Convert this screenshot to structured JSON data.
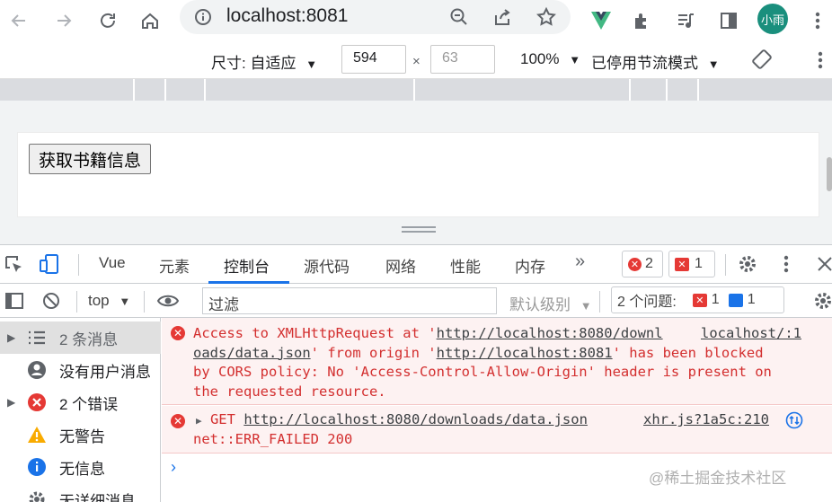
{
  "browser": {
    "url": "localhost:8081",
    "profile_name": "小雨",
    "icons": [
      "back-icon",
      "forward-icon",
      "reload-icon",
      "home-icon",
      "info-icon",
      "zoom-icon",
      "share-icon",
      "bookmark-star-icon",
      "vue-devtools-icon",
      "extensions-icon",
      "media-icon",
      "side-panel-icon",
      "menu-icon"
    ]
  },
  "device_toolbar": {
    "dimensions_label": "尺寸: 自适应",
    "width": "594",
    "height_placeholder": "63",
    "separator": "×",
    "zoom": "100%",
    "throttle": "已停用节流模式"
  },
  "page": {
    "button_label": "获取书籍信息"
  },
  "devtools": {
    "tabs": [
      {
        "label": "Vue"
      },
      {
        "label": "元素"
      },
      {
        "label": "控制台"
      },
      {
        "label": "源代码"
      },
      {
        "label": "网络"
      },
      {
        "label": "性能"
      },
      {
        "label": "内存"
      }
    ],
    "more_tabs": "»",
    "active_tab": "控制台",
    "error_count": "2",
    "issue_count": "1"
  },
  "console_toolbar": {
    "context": "top",
    "filter_placeholder": "过滤",
    "level": "默认级别",
    "issues_label": "2 个问题:",
    "issues_error": "1",
    "issues_info": "1"
  },
  "sidebar": {
    "items": [
      {
        "label": "2 条消息",
        "icon": "list-icon"
      },
      {
        "label": "没有用户消息",
        "icon": "user-icon"
      },
      {
        "label": "2 个错误",
        "icon": "error-icon"
      },
      {
        "label": "无警告",
        "icon": "warning-icon"
      },
      {
        "label": "无信息",
        "icon": "info-icon"
      },
      {
        "label": "无详细消息",
        "icon": "gear-icon"
      }
    ]
  },
  "messages": [
    {
      "line1_a": "Access to XMLHttpRequest at '",
      "line1_link": "http://localhost:8080/downl",
      "source_link": "localhost/:1",
      "line2_link": "oads/data.json",
      "line2_b": "' from origin '",
      "line2_link2": "http://localhost:8081",
      "line2_c": "' has been blocked",
      "line3": "by CORS policy: No 'Access-Control-Allow-Origin' header is present on",
      "line4": "the requested resource."
    },
    {
      "method": "GET",
      "url": "http://localhost:8080/downloads/data.json",
      "source": "xhr.js?1a5c:210",
      "status": "net::ERR_FAILED 200"
    }
  ],
  "watermark": "@稀土掘金技术社区"
}
